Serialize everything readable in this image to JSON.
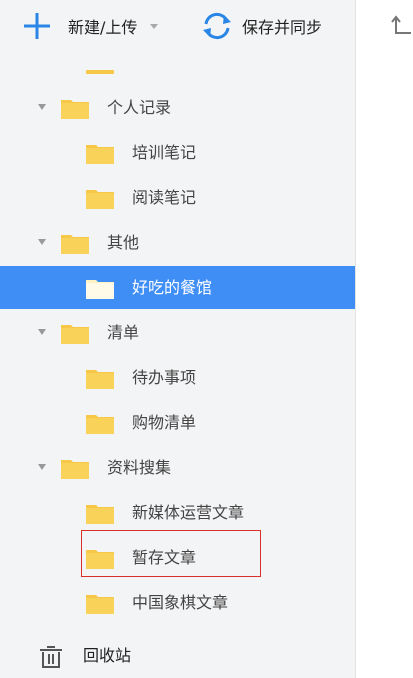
{
  "toolbar": {
    "new_label": "新建/上传",
    "sync_label": "保存并同步"
  },
  "tree": {
    "groups": [
      {
        "label": "个人记录",
        "children": [
          "培训笔记",
          "阅读笔记"
        ]
      },
      {
        "label": "其他",
        "children": [
          "好吃的餐馆"
        ]
      },
      {
        "label": "清单",
        "children": [
          "待办事项",
          "购物清单"
        ]
      },
      {
        "label": "资料搜集",
        "children": [
          "新媒体运营文章",
          "暂存文章",
          "中国象棋文章"
        ]
      }
    ],
    "selected_item": "好吃的餐馆",
    "highlighted_item": "暂存文章"
  },
  "trash": {
    "label": "回收站"
  },
  "colors": {
    "accent": "#3f8ef5",
    "folder": "#f7c748",
    "highlight_border": "#d9302c"
  }
}
